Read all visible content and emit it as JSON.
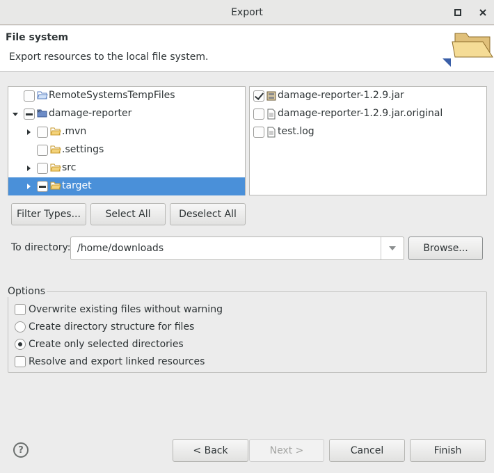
{
  "window": {
    "title": "Export"
  },
  "header": {
    "title": "File system",
    "description": "Export resources to the local file system."
  },
  "tree": {
    "items": [
      {
        "label": "RemoteSystemsTempFiles",
        "expander": "",
        "check": "unchecked",
        "icon": "folder-open-icon"
      },
      {
        "label": "damage-reporter",
        "expander": "expanded",
        "check": "mixed",
        "icon": "maven-project-icon"
      },
      {
        "label": ".mvn",
        "expander": "collapsed",
        "check": "unchecked",
        "icon": "folder-icon"
      },
      {
        "label": ".settings",
        "expander": "",
        "check": "unchecked",
        "icon": "folder-icon"
      },
      {
        "label": "src",
        "expander": "collapsed",
        "check": "unchecked",
        "icon": "folder-icon"
      },
      {
        "label": "target",
        "expander": "collapsed",
        "check": "mixed",
        "icon": "folder-icon",
        "selected": true
      }
    ]
  },
  "files": {
    "items": [
      {
        "label": "damage-reporter-1.2.9.jar",
        "check": "checked",
        "icon": "jar-icon"
      },
      {
        "label": "damage-reporter-1.2.9.jar.original",
        "check": "unchecked",
        "icon": "file-icon"
      },
      {
        "label": "test.log",
        "check": "unchecked",
        "icon": "file-icon"
      }
    ]
  },
  "selection_buttons": {
    "filter_types": "Filter Types...",
    "select_all": "Select All",
    "deselect_all": "Deselect All"
  },
  "destination": {
    "label": "To directory:",
    "value": "/home/downloads",
    "browse": "Browse..."
  },
  "options": {
    "title": "Options",
    "overwrite": "Overwrite existing files without warning",
    "create_structure": "Create directory structure for files",
    "create_selected": "Create only selected directories",
    "resolve_linked": "Resolve and export linked resources",
    "selected_radio": "create_selected"
  },
  "footer": {
    "back": "< Back",
    "next": "Next >",
    "cancel": "Cancel",
    "finish": "Finish"
  },
  "colors": {
    "selection": "#4a90d9",
    "background": "#ececec"
  }
}
